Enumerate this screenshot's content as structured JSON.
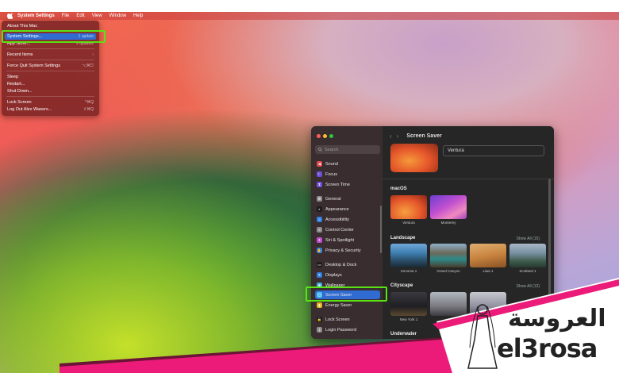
{
  "menubar": {
    "app": "System Settings",
    "items": [
      "File",
      "Edit",
      "View",
      "Window",
      "Help"
    ]
  },
  "apple_menu": {
    "items": [
      {
        "label": "About This Mac",
        "shortcut": ""
      },
      {
        "label": "System Settings...",
        "shortcut": "1 update"
      },
      {
        "label": "App Store...",
        "shortcut": "2 updates"
      },
      {
        "label": "Recent Items",
        "shortcut": "›"
      },
      {
        "label": "Force Quit System Settings",
        "shortcut": "⌥⌘⎋"
      },
      {
        "label": "Sleep",
        "shortcut": ""
      },
      {
        "label": "Restart...",
        "shortcut": ""
      },
      {
        "label": "Shut Down...",
        "shortcut": ""
      },
      {
        "label": "Lock Screen",
        "shortcut": "^⌘Q"
      },
      {
        "label": "Log Out Alex Waeers...",
        "shortcut": "⇧⌘Q"
      }
    ]
  },
  "window": {
    "search_placeholder": "Search",
    "sidebar": [
      {
        "label": "Sound",
        "color": "#e2494b"
      },
      {
        "label": "Focus",
        "color": "#6b4fd8"
      },
      {
        "label": "Screen Time",
        "color": "#6b4fd8"
      },
      {
        "label": "General",
        "color": "#8a8a8a"
      },
      {
        "label": "Appearance",
        "color": "#1c1c1c"
      },
      {
        "label": "Accessibility",
        "color": "#2f7ce0"
      },
      {
        "label": "Control Center",
        "color": "#8a8a8a"
      },
      {
        "label": "Siri & Spotlight",
        "color": "#c04fd0"
      },
      {
        "label": "Privacy & Security",
        "color": "#2f7ce0"
      },
      {
        "label": "Desktop & Dock",
        "color": "#1c1c1c"
      },
      {
        "label": "Displays",
        "color": "#2f7ce0"
      },
      {
        "label": "Wallpaper",
        "color": "#3fa8e0"
      },
      {
        "label": "Screen Saver",
        "color": "#4ac0e8"
      },
      {
        "label": "Energy Saver",
        "color": "#e8b020"
      },
      {
        "label": "Lock Screen",
        "color": "#1c1c1c"
      },
      {
        "label": "Login Password",
        "color": "#8a8a8a"
      }
    ],
    "title": "Screen Saver",
    "current_saver": "Ventura",
    "sections": {
      "macos": {
        "title": "macOS",
        "items": [
          "Ventura",
          "Monterey"
        ]
      },
      "landscape": {
        "title": "Landscape",
        "show_all": "Show All (15)",
        "items": [
          "Sonoma 1",
          "Grand Canyon",
          "Liwa 1",
          "Scotland 1"
        ]
      },
      "cityscape": {
        "title": "Cityscape",
        "show_all": "Show All (12)",
        "items": [
          "New York 1"
        ]
      },
      "underwater": {
        "title": "Underwater"
      }
    }
  },
  "watermark": {
    "arabic": "العروسة",
    "latin": "el3rosa",
    "colors": {
      "pink": "#ec1b7a",
      "dark": "#6b1436"
    }
  }
}
